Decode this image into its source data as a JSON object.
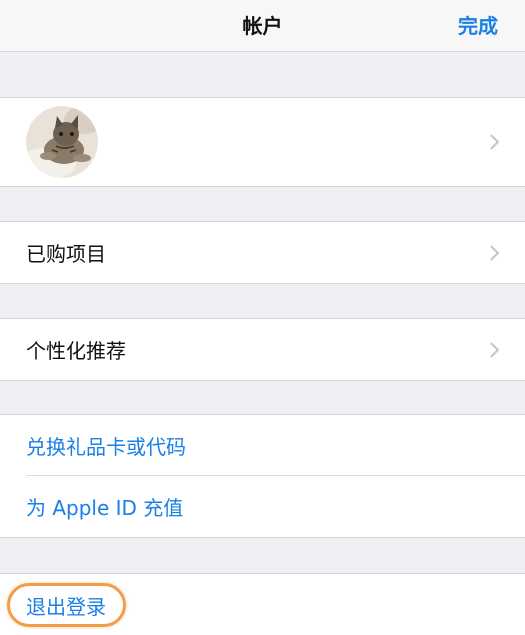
{
  "navbar": {
    "title": "帐户",
    "done_label": "完成"
  },
  "profile": {
    "avatar_icon": "cat-photo-avatar"
  },
  "items": {
    "purchased": "已购项目",
    "personalized": "个性化推荐",
    "redeem": "兑换礼品卡或代码",
    "add_funds": "为 Apple ID 充值",
    "sign_out": "退出登录"
  },
  "colors": {
    "accent": "#1a7fe6",
    "highlight_ring": "#f39c4a",
    "background": "#efeff4"
  }
}
